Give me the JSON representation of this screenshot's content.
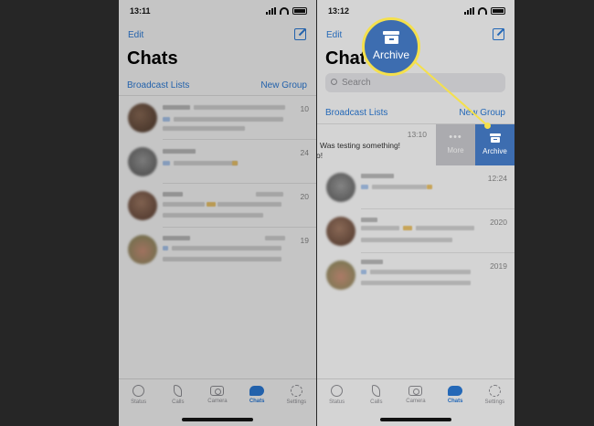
{
  "colors": {
    "accent": "#2b7ad6",
    "archive_blue": "#3d6db0",
    "highlight_yellow": "#f4e04d",
    "frame": "#262626"
  },
  "left_screen": {
    "status_time": "13:11",
    "edit_label": "Edit",
    "title": "Chats",
    "broadcast_label": "Broadcast Lists",
    "new_group_label": "New Group",
    "chats": [
      {
        "time": "10"
      },
      {
        "time": "24"
      },
      {
        "time": "20"
      },
      {
        "time": "19"
      }
    ]
  },
  "right_screen": {
    "status_time": "13:12",
    "edit_label": "Edit",
    "title": "Chats",
    "search_placeholder": "Search",
    "broadcast_label": "Broadcast Lists",
    "new_group_label": "New Group",
    "swiped_chat": {
      "time": "13:10",
      "preview": "Was testing something!",
      "preview_tail": "o!"
    },
    "swipe_actions": {
      "more_label": "More",
      "archive_label": "Archive"
    },
    "chats": [
      {
        "time": "12:24"
      },
      {
        "time": "2020"
      },
      {
        "time": "2019"
      }
    ]
  },
  "callout": {
    "label": "Archive",
    "icon": "archive-box-icon"
  },
  "tabs": [
    {
      "label": "Status",
      "icon": "status-icon"
    },
    {
      "label": "Calls",
      "icon": "phone-icon"
    },
    {
      "label": "Camera",
      "icon": "camera-icon"
    },
    {
      "label": "Chats",
      "icon": "chat-bubbles-icon"
    },
    {
      "label": "Settings",
      "icon": "gear-icon"
    }
  ]
}
